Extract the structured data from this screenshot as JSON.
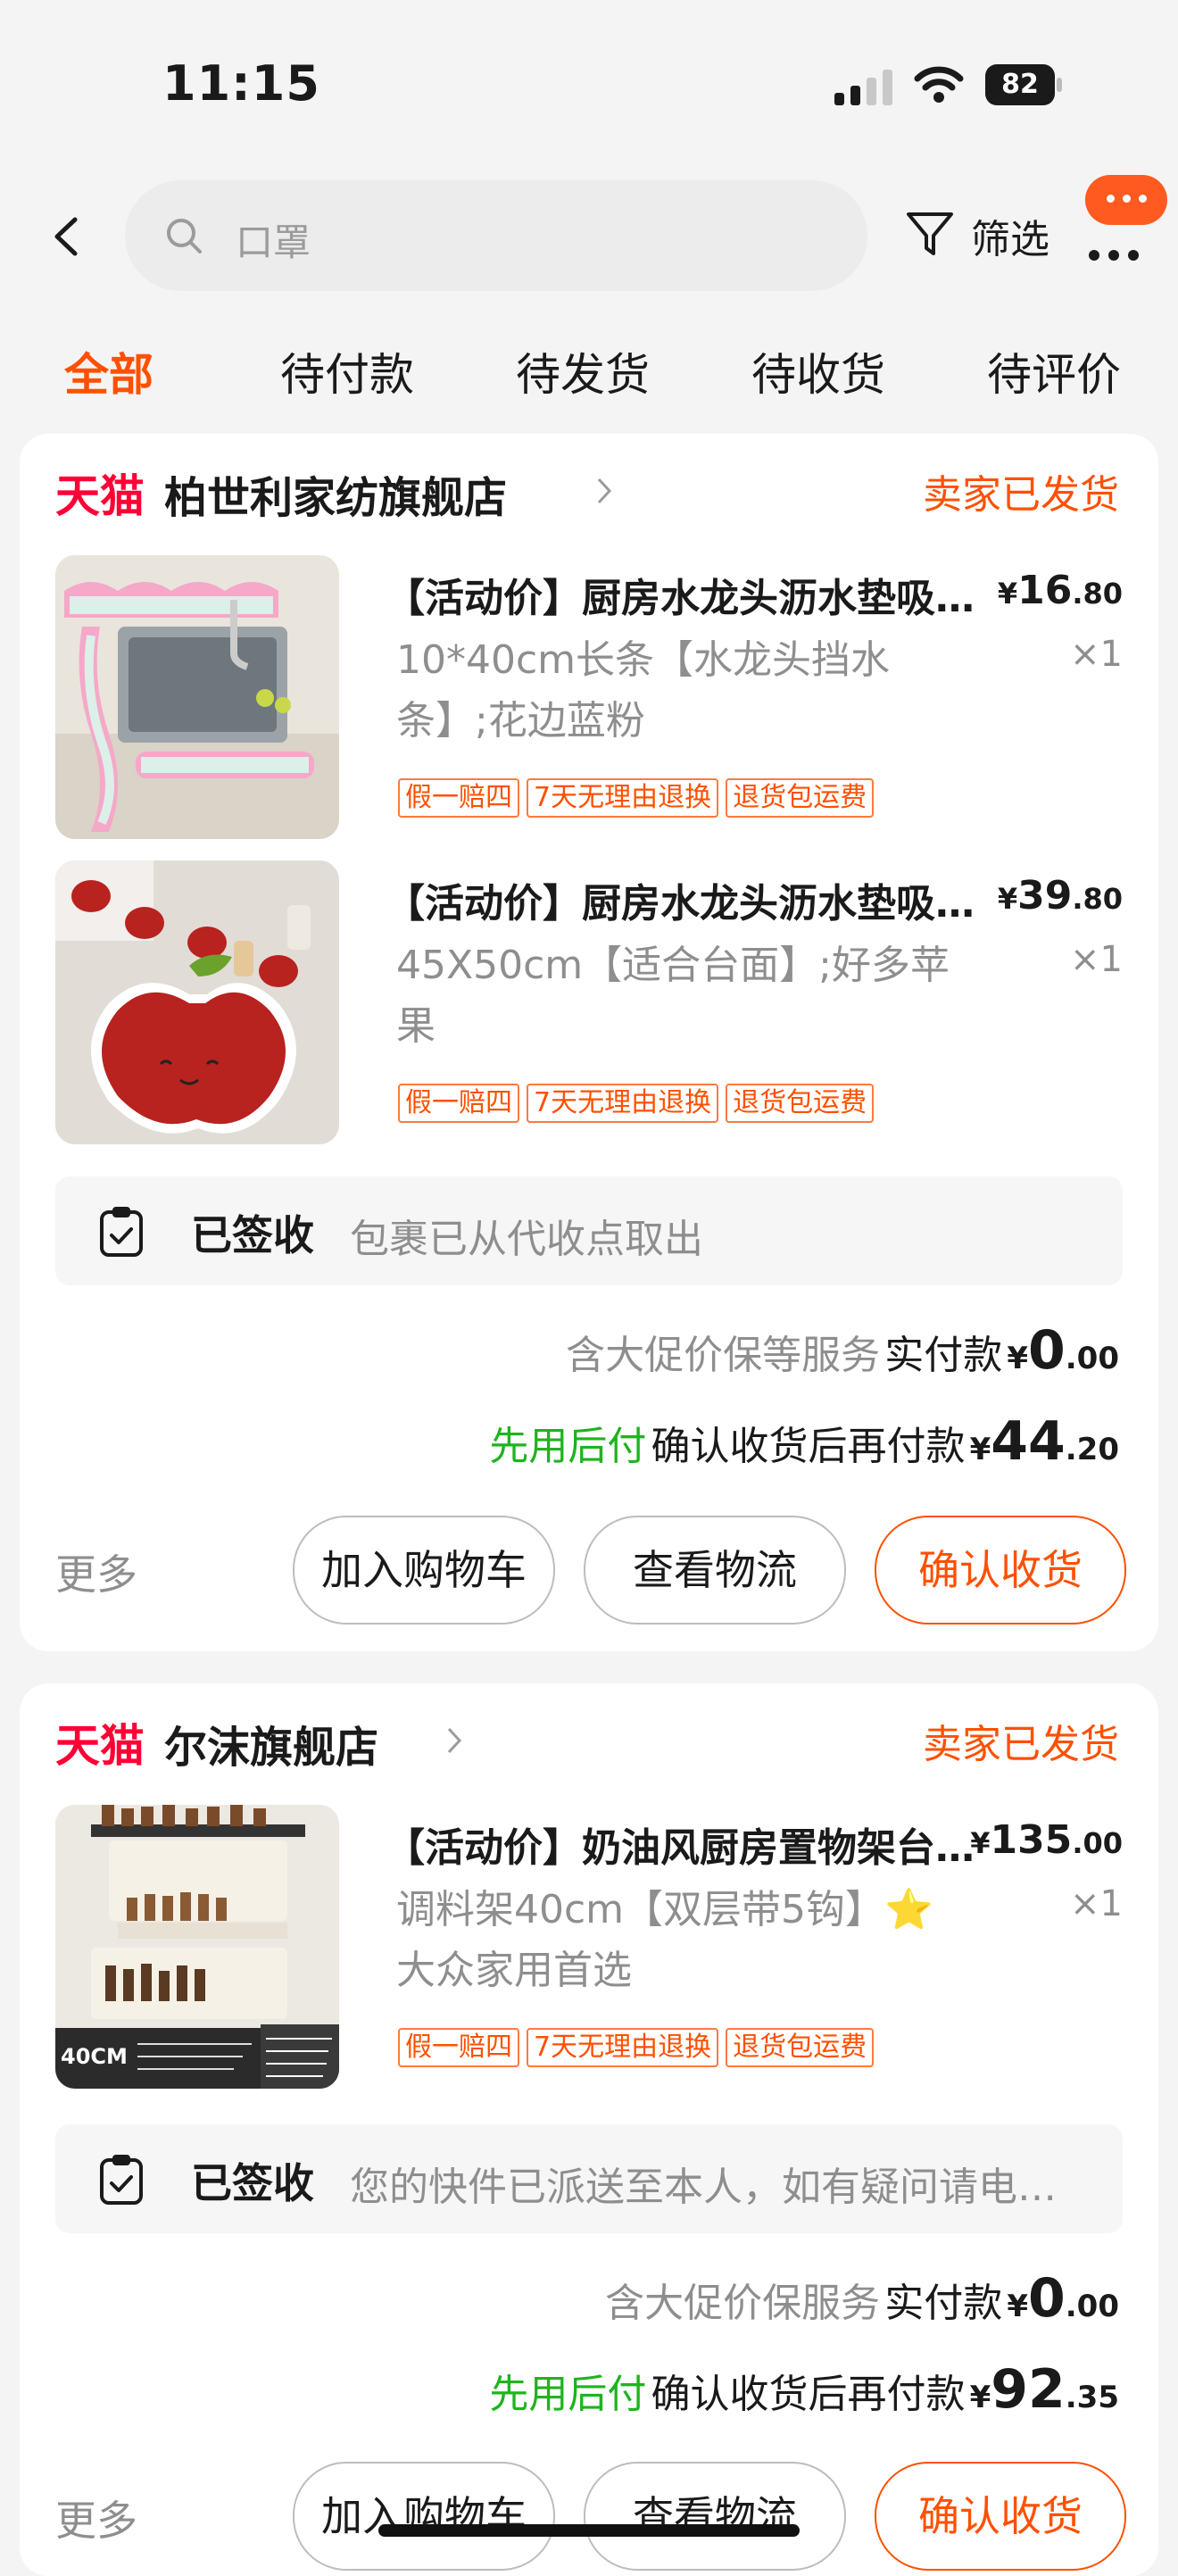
{
  "status_bar": {
    "time": "11:15",
    "battery": "82"
  },
  "search": {
    "placeholder": "口罩"
  },
  "filter": {
    "label": "筛选"
  },
  "tabs": [
    "全部",
    "待付款",
    "待发货",
    "待收货",
    "待评价"
  ],
  "orders": [
    {
      "platform": "天猫",
      "shop": "柏世利家纺旗舰店",
      "status": "卖家已发货",
      "items": [
        {
          "title": "【活动价】厨房水龙头沥水垫吸水硅藻泥",
          "price_symbol": "¥",
          "price_int": "16",
          "price_dec": ".80",
          "sku": "10*40cm长条【水龙头挡水条】;花边蓝粉",
          "qty": "×1",
          "tags": [
            "假一赔四",
            "7天无理由退换",
            "退货包运费"
          ]
        },
        {
          "title": "【活动价】厨房水龙头沥水垫吸水硅藻泥",
          "price_symbol": "¥",
          "price_int": "39",
          "price_dec": ".80",
          "sku": "45X50cm【适合台面】;好多苹果",
          "qty": "×1",
          "tags": [
            "假一赔四",
            "7天无理由退换",
            "退货包运费"
          ]
        }
      ],
      "delivery": {
        "status": "已签收",
        "desc": "包裹已从代收点取出"
      },
      "service_note": "含大促价保等服务",
      "paid_label": "实付款",
      "paid_symbol": "¥",
      "paid_int": "0",
      "paid_dec": ".00",
      "bnpl_label": "先用后付",
      "later_label": "确认收货后再付款",
      "later_symbol": "¥",
      "later_int": "44",
      "later_dec": ".20",
      "more": "更多",
      "buttons": [
        "加入购物车",
        "查看物流",
        "确认收货"
      ]
    },
    {
      "platform": "天猫",
      "shop": "尔沫旗舰店",
      "status": "卖家已发货",
      "items": [
        {
          "title": "【活动价】奶油风厨房置物架台面多功能",
          "price_symbol": "¥",
          "price_int": "135",
          "price_dec": ".00",
          "sku": "调料架40cm【双层带5钩】⭐大众家用首选",
          "qty": "×1",
          "tags": [
            "假一赔四",
            "7天无理由退换",
            "退货包运费"
          ],
          "thumb_badge": "40CM"
        }
      ],
      "delivery": {
        "status": "已签收",
        "desc": "您的快件已派送至本人，如有疑问请电联快递员"
      },
      "service_note": "含大促价保服务",
      "paid_label": "实付款",
      "paid_symbol": "¥",
      "paid_int": "0",
      "paid_dec": ".00",
      "bnpl_label": "先用后付",
      "later_label": "确认收货后再付款",
      "later_symbol": "¥",
      "later_int": "92",
      "later_dec": ".35",
      "more": "更多",
      "buttons": [
        "加入购物车",
        "查看物流",
        "确认收货"
      ]
    }
  ],
  "colors": {
    "accent": "#ff5000",
    "tmall": "#ff0036",
    "bnpl": "#1fb31f"
  }
}
